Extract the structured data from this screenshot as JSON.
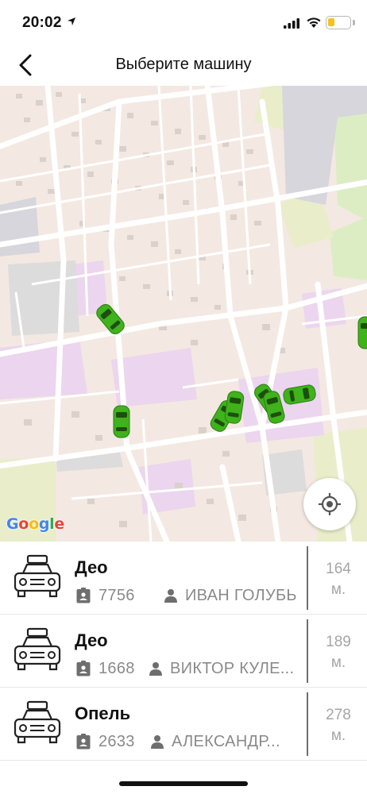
{
  "status": {
    "time": "20:02",
    "battery_percent": 30
  },
  "nav": {
    "title": "Выберите машину"
  },
  "map": {
    "attribution": "Google"
  },
  "cars": [
    {
      "name": "Део",
      "plate": "7756",
      "driver": "ИВАН ГОЛУБЬ",
      "distance_value": "164",
      "distance_unit": "м."
    },
    {
      "name": "Део",
      "plate": "1668",
      "driver": "ВИКТОР КУЛЕ...",
      "distance_value": "189",
      "distance_unit": "м."
    },
    {
      "name": "Опель",
      "plate": "2633",
      "driver": "АЛЕКСАНДР...",
      "distance_value": "278",
      "distance_unit": "м."
    }
  ],
  "colors": {
    "car_marker": "#3fb21c",
    "map_bg": "#f4e8e2",
    "park": "#dcedc4",
    "institution": "#ecd5ee"
  }
}
